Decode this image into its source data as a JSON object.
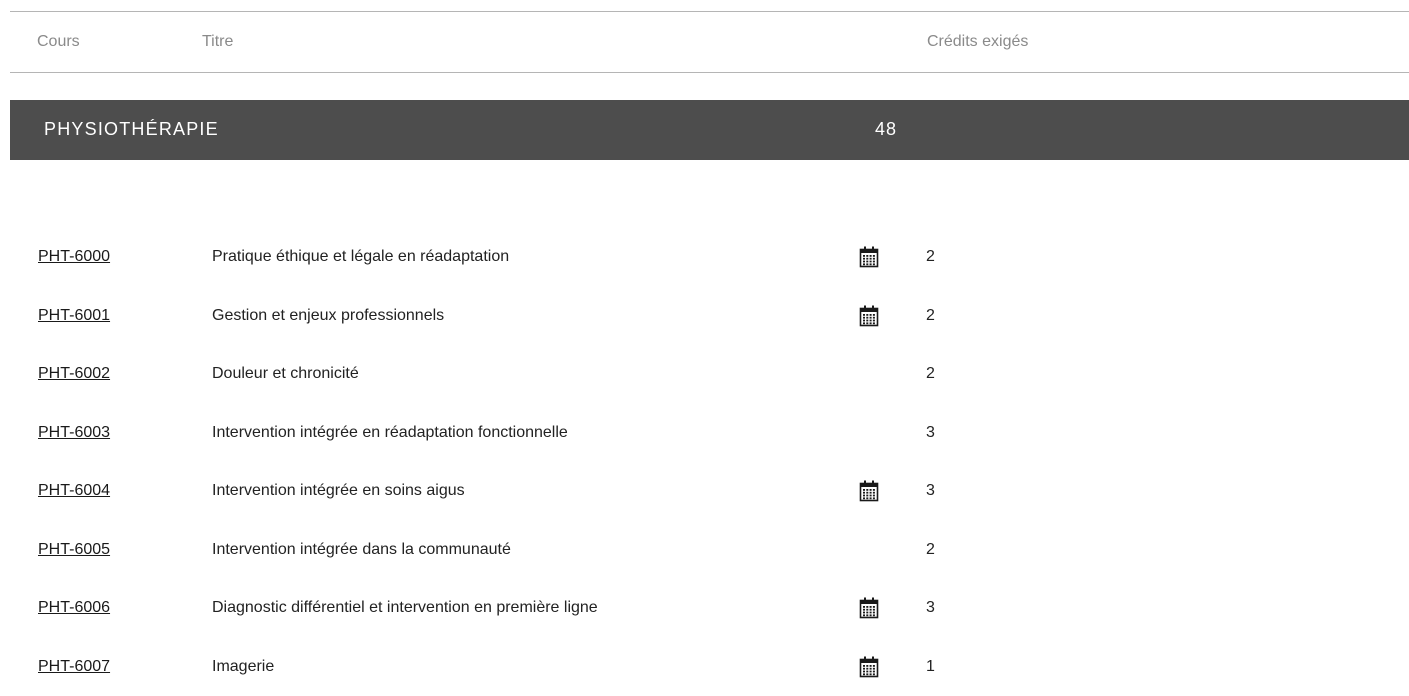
{
  "header": {
    "col_course": "Cours",
    "col_title": "Titre",
    "col_credits": "Crédits exigés"
  },
  "section": {
    "title": "PHYSIOTHÉRAPIE",
    "credits": "48"
  },
  "icons": {
    "schedule": "calendar-icon"
  },
  "courses": [
    {
      "code": "PHT-6000",
      "title": "Pratique éthique et légale en réadaptation",
      "calendar": true,
      "credits": "2"
    },
    {
      "code": "PHT-6001",
      "title": "Gestion et enjeux professionnels",
      "calendar": true,
      "credits": "2"
    },
    {
      "code": "PHT-6002",
      "title": "Douleur et chronicité",
      "calendar": false,
      "credits": "2"
    },
    {
      "code": "PHT-6003",
      "title": "Intervention intégrée en réadaptation fonctionnelle",
      "calendar": false,
      "credits": "3"
    },
    {
      "code": "PHT-6004",
      "title": "Intervention intégrée en soins aigus",
      "calendar": true,
      "credits": "3"
    },
    {
      "code": "PHT-6005",
      "title": "Intervention intégrée dans la communauté",
      "calendar": false,
      "credits": "2"
    },
    {
      "code": "PHT-6006",
      "title": "Diagnostic différentiel et intervention en première ligne",
      "calendar": true,
      "credits": "3"
    },
    {
      "code": "PHT-6007",
      "title": "Imagerie",
      "calendar": true,
      "credits": "1"
    }
  ]
}
